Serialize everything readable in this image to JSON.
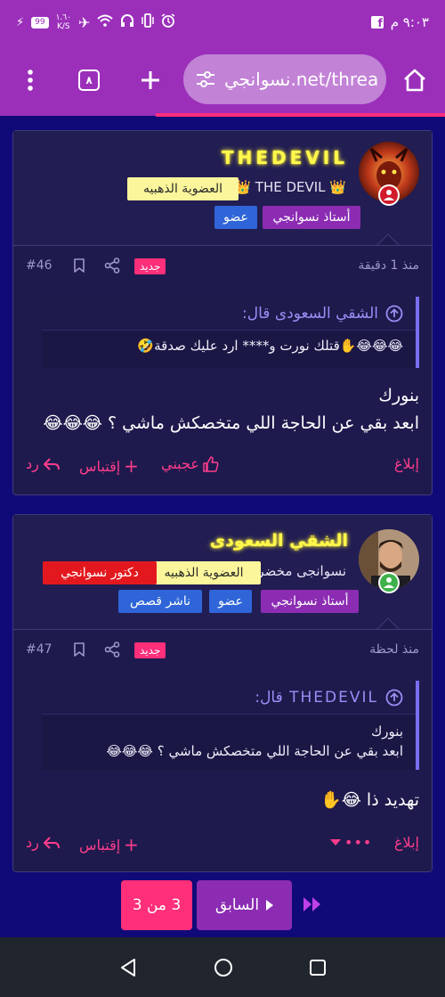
{
  "status": {
    "time": "٩:٠٣ م",
    "net_speed": "١.٦٠",
    "net_unit": "K/S",
    "battery": "99"
  },
  "browser": {
    "url": "نسوانجي.net/threa",
    "tabs_count": "٨"
  },
  "posts": [
    {
      "username": "THEDEVIL",
      "user_title": "👑 THE DEVIL 👑",
      "badges": [
        "العضوية الذهبيه",
        "أستاذ نسوانجي",
        "عضو"
      ],
      "time": "منذ 1 دقيقة",
      "new_label": "جديد",
      "number": "#46",
      "quote_author": "الشقي السعودى قال:",
      "quote_text": "😂😂😂✋قتلك نورت و**** ارد عليك صدقة🤣",
      "body_line1": "بنورك",
      "body_line2": "ابعد بقي عن الحاجة اللي متخصكش ماشي ؟ 😂😂😂",
      "report": "إبلاغ",
      "like": "عجبني",
      "quote": "إقتباس",
      "reply": "رد"
    },
    {
      "username": "الشقي السعودى",
      "user_title": "نسوانجى مخضرم",
      "badges": [
        "العضوية الذهبيه",
        "دكتور نسوانجي",
        "أستاذ نسوانجي",
        "عضو",
        "ناشر قصص"
      ],
      "time": "منذ لحظة",
      "new_label": "جديد",
      "number": "#47",
      "quote_author": "THEDEVIL قال:",
      "quote_line1": "بنورك",
      "quote_line2": "ابعد بقي عن الحاجة اللي متخصكش ماشي ؟ 😂😂😂",
      "body_line1": "تهديد ذا 😂✋",
      "report": "إبلاغ",
      "more": "•••",
      "quote": "إقتباس",
      "reply": "رد"
    }
  ],
  "pagination": {
    "page_indicator": "3 من 3",
    "prev_label": "السابق"
  }
}
